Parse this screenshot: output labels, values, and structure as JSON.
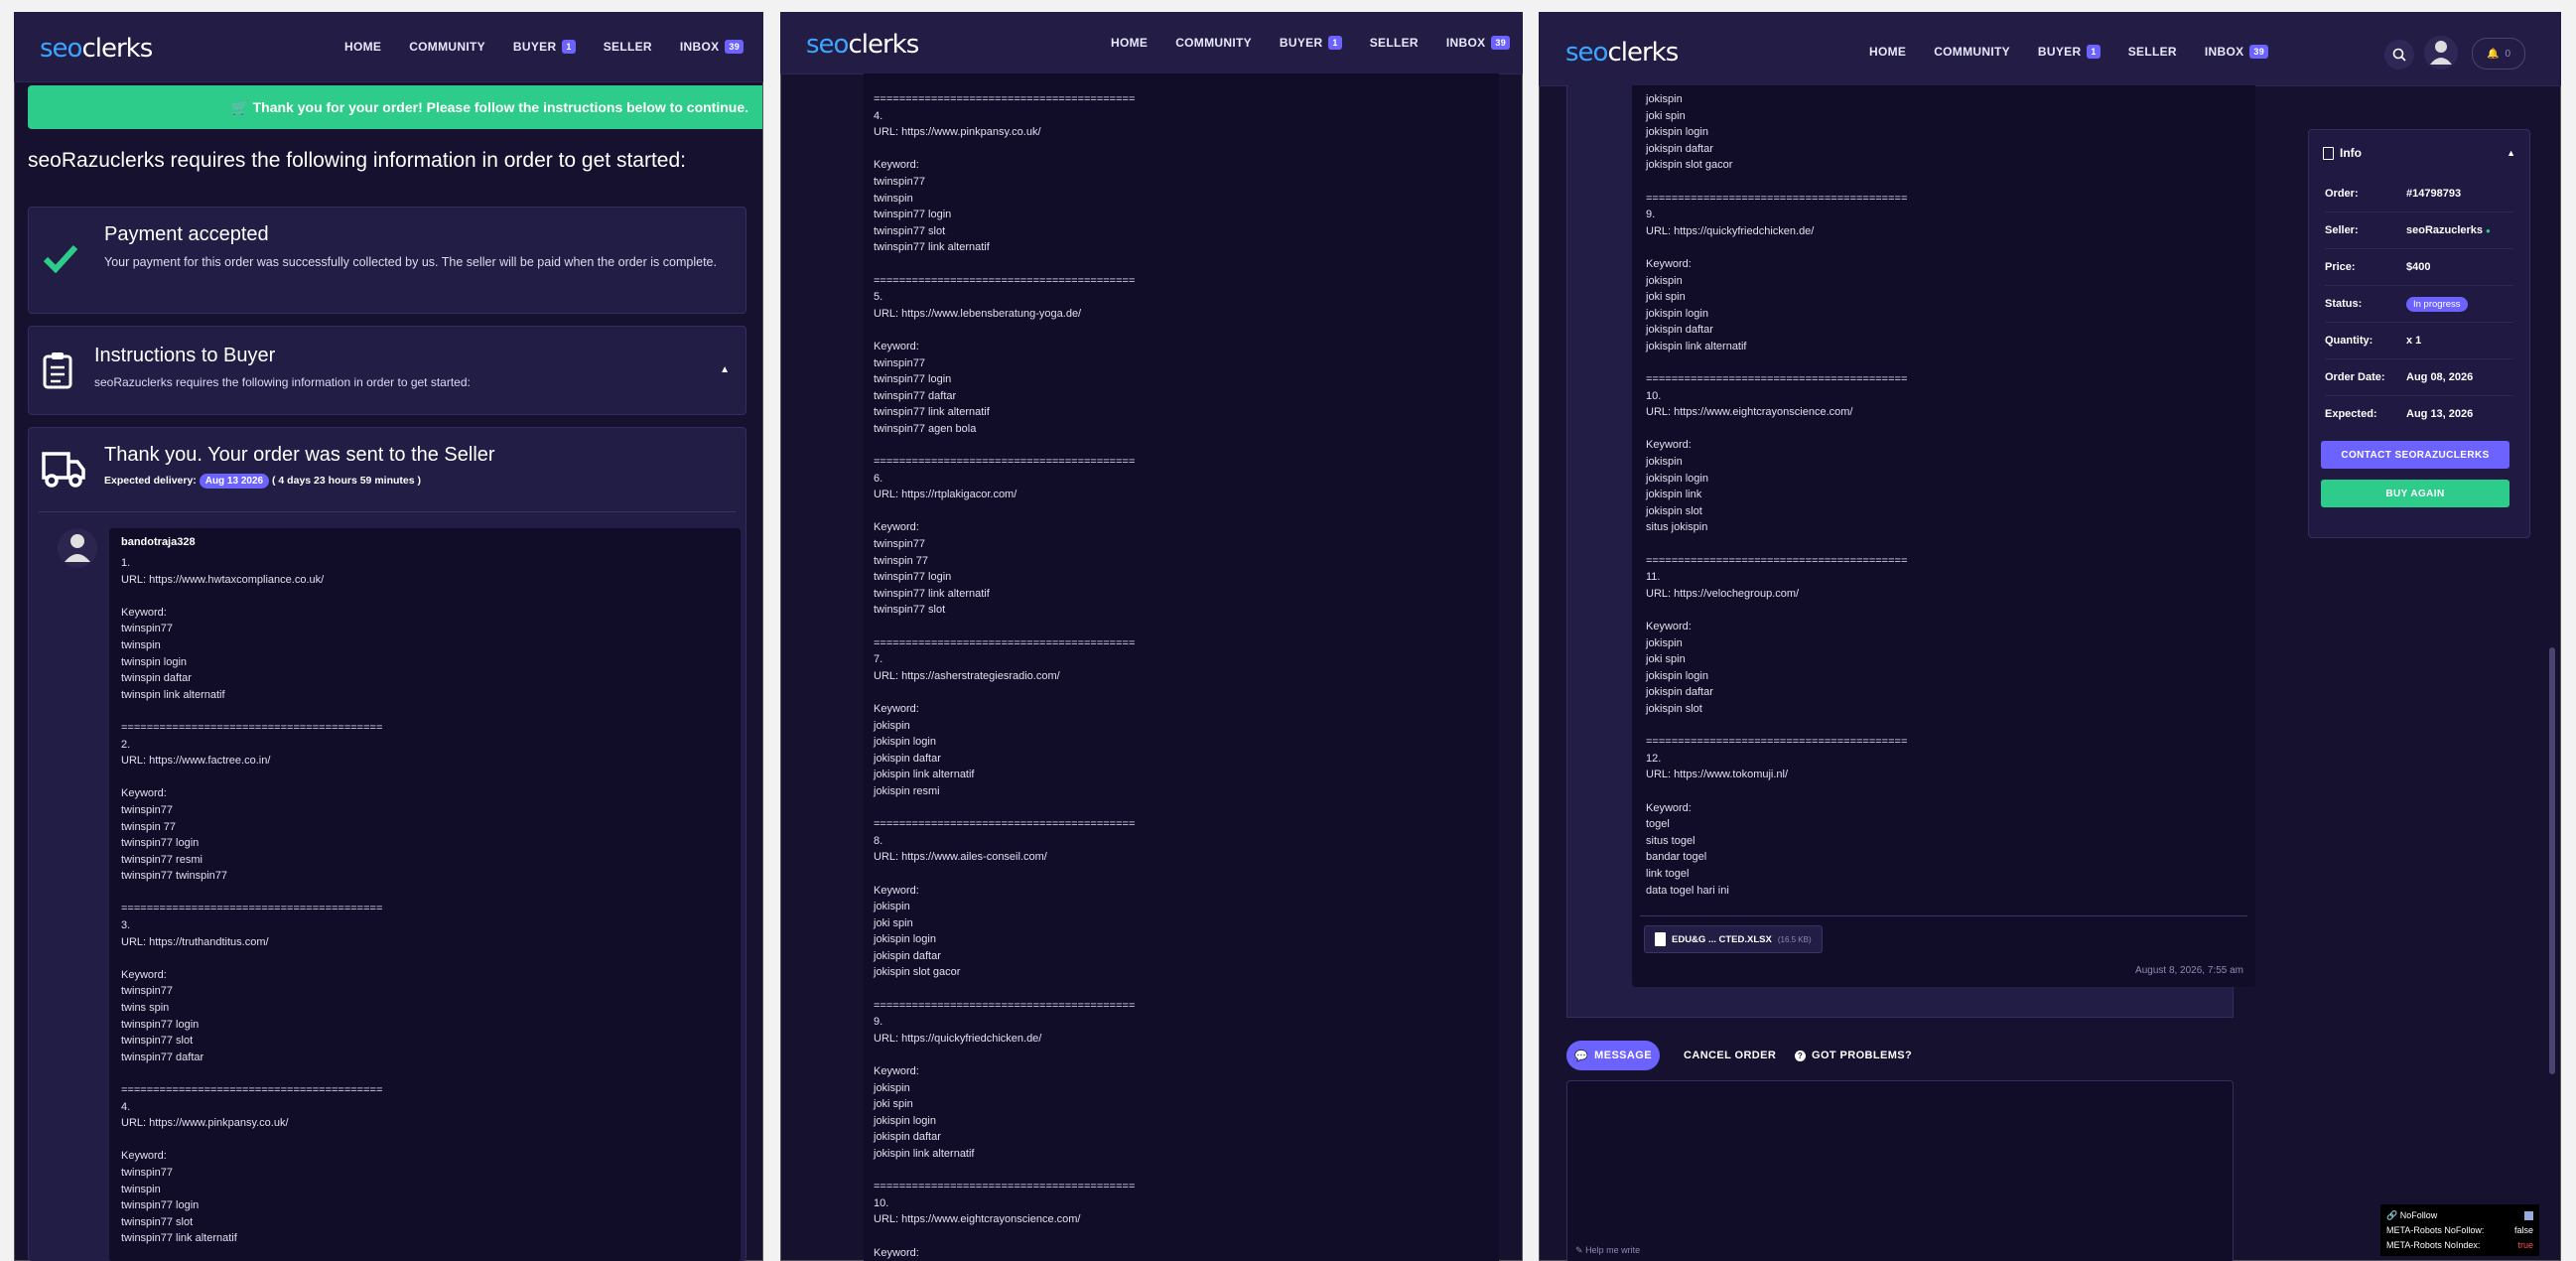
{
  "nav": {
    "logo_a": "seo",
    "logo_b": "clerks",
    "home": "HOME",
    "community": "COMMUNITY",
    "buyer": "BUYER",
    "buyer_count": "1",
    "seller": "SELLER",
    "inbox": "INBOX",
    "inbox_count": "39",
    "bell_count": "0"
  },
  "banner": "🛒 Thank you for your order! Please follow the instructions below to continue.",
  "heading": "seoRazuclerks requires the following information in order to get started:",
  "payment": {
    "title": "Payment accepted",
    "text": "Your payment for this order was successfully collected by us. The seller will be paid when the order is complete."
  },
  "instructions": {
    "title": "Instructions to Buyer",
    "text": "seoRazuclerks requires the following information in order to get started:"
  },
  "sent": {
    "title": "Thank you. Your order was sent to the Seller",
    "expected_label": "Expected delivery:",
    "expected_date": "Aug 13 2026",
    "remaining": "( 4 days 23 hours 59 minutes )"
  },
  "message": {
    "author": "bandotraja328",
    "part1": "1.\nURL: https://www.hwtaxcompliance.co.uk/\n\nKeyword:\ntwinspin77\ntwinspin\ntwinspin login\ntwinspin daftar\ntwinspin link alternatif\n\n=========================================\n2.\nURL: https://www.factree.co.in/\n\nKeyword:\ntwinspin77\ntwinspin 77\ntwinspin77 login\ntwinspin77 resmi\ntwinspin77 twinspin77\n\n=========================================\n3.\nURL: https://truthandtitus.com/\n\nKeyword:\ntwinspin77\ntwins spin\ntwinspin77 login\ntwinspin77 slot\ntwinspin77 daftar\n\n=========================================\n4.\nURL: https://www.pinkpansy.co.uk/\n\nKeyword:\ntwinspin77\ntwinspin\ntwinspin77 login\ntwinspin77 slot\ntwinspin77 link alternatif",
    "part2": "=========================================\n4.\nURL: https://www.pinkpansy.co.uk/\n\nKeyword:\ntwinspin77\ntwinspin\ntwinspin77 login\ntwinspin77 slot\ntwinspin77 link alternatif\n\n=========================================\n5.\nURL: https://www.lebensberatung-yoga.de/\n\nKeyword:\ntwinspin77\ntwinspin77 login\ntwinspin77 daftar\ntwinspin77 link alternatif\ntwinspin77 agen bola\n\n=========================================\n6.\nURL: https://rtplakigacor.com/\n\nKeyword:\ntwinspin77\ntwinspin 77\ntwinspin77 login\ntwinspin77 link alternatif\ntwinspin77 slot\n\n=========================================\n7.\nURL: https://asherstrategiesradio.com/\n\nKeyword:\njokispin\njokispin login\njokispin daftar\njokispin link alternatif\njokispin resmi\n\n=========================================\n8.\nURL: https://www.ailes-conseil.com/\n\nKeyword:\njokispin\njoki spin\njokispin login\njokispin daftar\njokispin slot gacor\n\n=========================================\n9.\nURL: https://quickyfriedchicken.de/\n\nKeyword:\njokispin\njoki spin\njokispin login\njokispin daftar\njokispin link alternatif\n\n=========================================\n10.\nURL: https://www.eightcrayonscience.com/\n\nKeyword:\njokispin",
    "part3": "jokispin\njoki spin\njokispin login\njokispin daftar\njokispin slot gacor\n\n=========================================\n9.\nURL: https://quickyfriedchicken.de/\n\nKeyword:\njokispin\njoki spin\njokispin login\njokispin daftar\njokispin link alternatif\n\n=========================================\n10.\nURL: https://www.eightcrayonscience.com/\n\nKeyword:\njokispin\njokispin login\njokispin link\njokispin slot\nsitus jokispin\n\n=========================================\n11.\nURL: https://velochegroup.com/\n\nKeyword:\njokispin\njoki spin\njokispin login\njokispin daftar\njokispin slot\n\n=========================================\n12.\nURL: https://www.tokomuji.nl/\n\nKeyword:\ntogel\nsitus togel\nbandar togel\nlink togel\ndata togel hari ini",
    "attachment": "EDU&G ... CTED.XLSX",
    "attachment_size": "(16.5 KB)",
    "timestamp": "August 8, 2026, 7:55 am"
  },
  "info": {
    "title": "Info",
    "rows": [
      {
        "k": "Order:",
        "v": "#14798793"
      },
      {
        "k": "Seller:",
        "v": "seoRazuclerks"
      },
      {
        "k": "Price:",
        "v": "$400"
      },
      {
        "k": "Status:",
        "v": "In progress"
      },
      {
        "k": "Quantity:",
        "v": "x 1"
      },
      {
        "k": "Order Date:",
        "v": "Aug 08, 2026"
      },
      {
        "k": "Expected:",
        "v": "Aug 13, 2026"
      }
    ],
    "contact": "CONTACT SEORAZUCLERKS",
    "buy_again": "BUY AGAIN"
  },
  "tabs": {
    "message": "MESSAGE",
    "cancel": "CANCEL ORDER",
    "problems": "GOT PROBLEMS?"
  },
  "composer": {
    "helper": "Help me write"
  },
  "seo_overlay": {
    "title": "NoFollow",
    "row1_label": "META-Robots NoFollow:",
    "row1_value": "false",
    "row2_label": "META-Robots NoIndex:",
    "row2_value": "true"
  },
  "colors": {
    "accent": "#6c63ff",
    "success": "#2ecc8b",
    "bg": "#15112f"
  }
}
